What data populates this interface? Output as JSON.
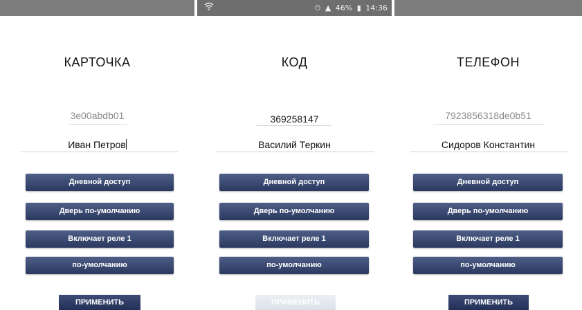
{
  "status": {
    "battery": "46%",
    "time": "14:36"
  },
  "panels": [
    {
      "title": "КАРТОЧКА",
      "code": "3e00abdb01",
      "name": "Иван Петров",
      "buttons": [
        "Дневной доступ",
        "Дверь по-умолчанию",
        "Включает реле 1",
        "по-умолчанию"
      ],
      "apply": "ПРИМЕНИТЬ",
      "apply_enabled": true
    },
    {
      "title": "КОД",
      "code": "369258147",
      "name": "Василий Теркин",
      "buttons": [
        "Дневной доступ",
        "Дверь по-умолчанию",
        "Включает реле 1",
        "по-умолчанию"
      ],
      "apply": "ПРИМЕНИТЬ",
      "apply_enabled": false
    },
    {
      "title": "ТЕЛЕФОН",
      "code": "7923856318de0b51",
      "name": "Сидоров Константин",
      "buttons": [
        "Дневной доступ",
        "Дверь по-умолчанию",
        "Включает реле 1",
        "по-умолчанию"
      ],
      "apply": "ПРИМЕНИТЬ",
      "apply_enabled": true
    }
  ],
  "colors": {
    "button": "#3a4870",
    "apply_disabled": "#e4e7ee",
    "statusbar": "#6e6e6e"
  },
  "icons": {
    "wifi": "wifi-icon",
    "battery": "battery-icon",
    "signal": "signal-icon",
    "alarm": "alarm-icon"
  }
}
